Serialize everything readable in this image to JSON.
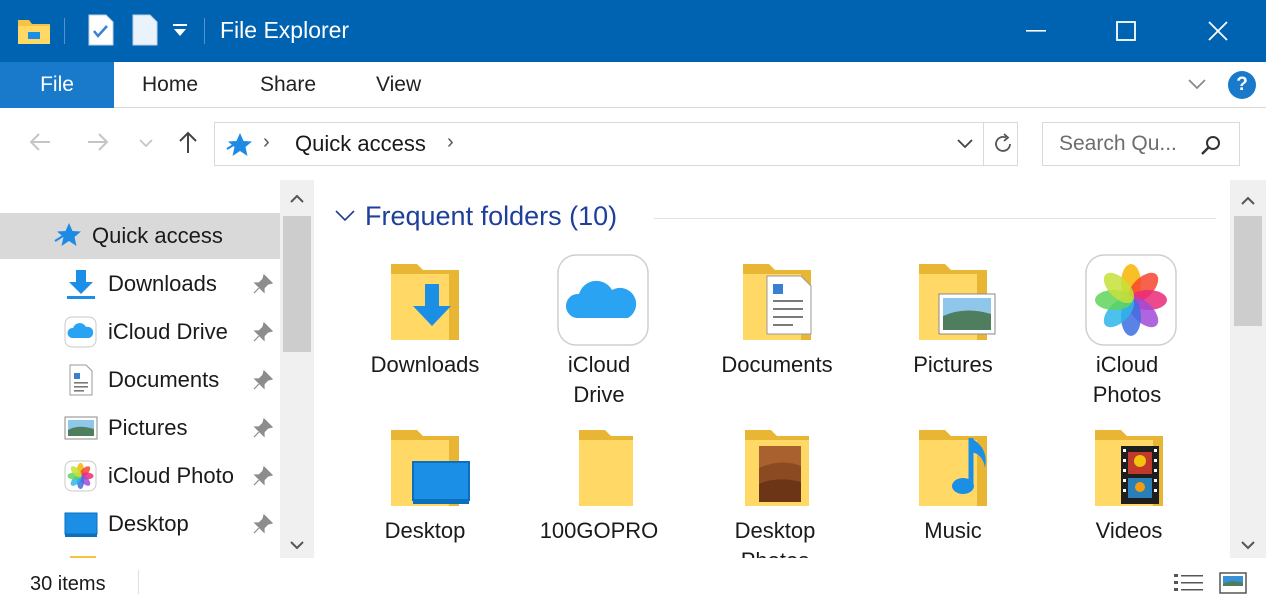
{
  "window": {
    "title": "File Explorer",
    "accent": "#0063b1"
  },
  "ribbon": {
    "tabs": [
      {
        "label": "File"
      },
      {
        "label": "Home"
      },
      {
        "label": "Share"
      },
      {
        "label": "View"
      }
    ],
    "help_label": "?"
  },
  "address": {
    "location": "Quick access",
    "search_placeholder": "Search Qu..."
  },
  "navpane": {
    "items": [
      {
        "label": "Quick access",
        "icon": "quick-access-star-icon",
        "selected": true
      },
      {
        "label": "Downloads",
        "icon": "downloads-arrow-icon",
        "pinned": true
      },
      {
        "label": "iCloud Drive",
        "icon": "icloud-drive-icon",
        "pinned": true
      },
      {
        "label": "Documents",
        "icon": "documents-icon",
        "pinned": true
      },
      {
        "label": "Pictures",
        "icon": "pictures-icon",
        "pinned": true
      },
      {
        "label": "iCloud Photo",
        "icon": "icloud-photos-icon",
        "pinned": true
      },
      {
        "label": "Desktop",
        "icon": "desktop-icon",
        "pinned": true
      }
    ]
  },
  "content": {
    "group_title": "Frequent folders (10)",
    "folders": [
      {
        "label": "Downloads",
        "icon": "folder-downloads-icon"
      },
      {
        "label": "iCloud\nDrive",
        "icon": "icloud-drive-icon"
      },
      {
        "label": "Documents",
        "icon": "folder-documents-icon"
      },
      {
        "label": "Pictures",
        "icon": "folder-pictures-icon"
      },
      {
        "label": "iCloud\nPhotos",
        "icon": "icloud-photos-icon"
      },
      {
        "label": "Desktop",
        "icon": "folder-desktop-icon"
      },
      {
        "label": "100GOPRO",
        "icon": "folder-icon"
      },
      {
        "label": "Desktop\nPhotos",
        "icon": "folder-photo-icon"
      },
      {
        "label": "Music",
        "icon": "folder-music-icon"
      },
      {
        "label": "Videos",
        "icon": "folder-videos-icon"
      }
    ]
  },
  "status": {
    "item_count": "30 items"
  }
}
